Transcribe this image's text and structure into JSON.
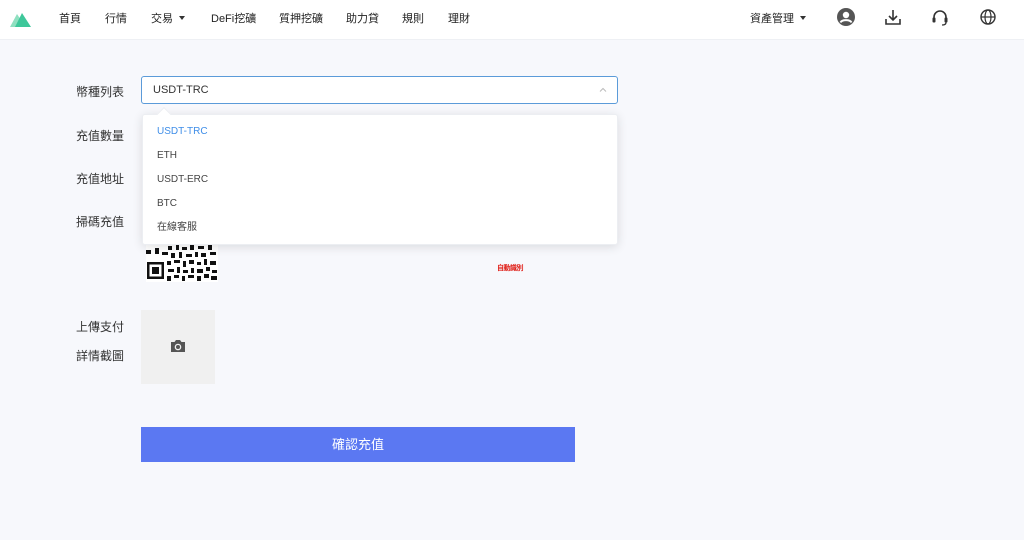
{
  "nav": {
    "items": [
      "首頁",
      "行情",
      "交易",
      "DeFi挖礦",
      "質押挖礦",
      "助力貸",
      "規則",
      "理財"
    ],
    "asset_management": "資產管理"
  },
  "form": {
    "currency_label": "幣種列表",
    "amount_label": "充值數量",
    "address_label": "充值地址",
    "scan_label": "掃碼充值",
    "upload_label_1": "上傳支付",
    "upload_label_2": "詳情截圖",
    "selected_currency": "USDT-TRC",
    "options": [
      "USDT-TRC",
      "ETH",
      "USDT-ERC",
      "BTC",
      "在線客服"
    ],
    "stamp_text": "自動識別",
    "submit_label": "確認充值"
  },
  "icons": {
    "logo": "logo-icon",
    "user": "user-icon",
    "download": "download-icon",
    "support": "headset-icon",
    "language": "globe-icon",
    "camera": "camera-icon"
  },
  "colors": {
    "accent": "#5b78f2",
    "selected_option": "#3f8ee8",
    "select_border": "#5b9bd9",
    "logo_green": "#3ec79a"
  }
}
